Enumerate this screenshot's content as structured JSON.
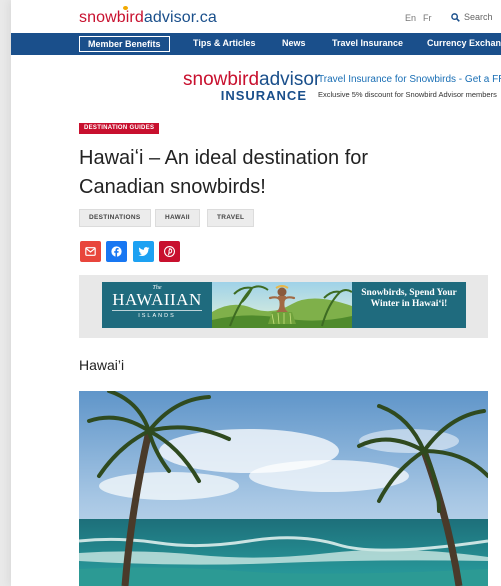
{
  "header": {
    "logo": {
      "part1": "snow",
      "part2": "bird",
      "part3": "advisor",
      "part4": ".ca"
    },
    "lang_en": "En",
    "lang_fr": "Fr",
    "search_label": "Search"
  },
  "nav": {
    "member_benefits": "Member Benefits",
    "items": [
      "Tips & Articles",
      "News",
      "Travel Insurance",
      "Currency Exchange"
    ]
  },
  "insurance_banner": {
    "logo_top_a": "snowbird",
    "logo_top_b": "advisor",
    "logo_bottom": "INSURANCE",
    "title": "Travel Insurance for Snowbirds - Get a FREE Quote",
    "subtitle": "Exclusive 5% discount for Snowbird Advisor members"
  },
  "article": {
    "category": "DESTINATION GUIDES",
    "title": "Hawaiʻi – An ideal destination for Canadian snowbirds!",
    "tags": [
      "DESTINATIONS",
      "HAWAII",
      "TRAVEL"
    ],
    "share_icons": [
      "email-icon",
      "facebook-icon",
      "twitter-icon",
      "pinterest-icon"
    ],
    "section_heading": "Hawai’i"
  },
  "ad": {
    "brand_the": "The",
    "brand_name": "HAWAIIAN",
    "brand_sub": "ISLANDS",
    "text": "Snowbirds, Spend Your Winter in Hawai‘i!"
  },
  "colors": {
    "brand_red": "#c8102e",
    "brand_blue": "#1a4f8b",
    "link_blue": "#1a6fb5",
    "facebook": "#1877f2",
    "twitter": "#1da1f2"
  }
}
